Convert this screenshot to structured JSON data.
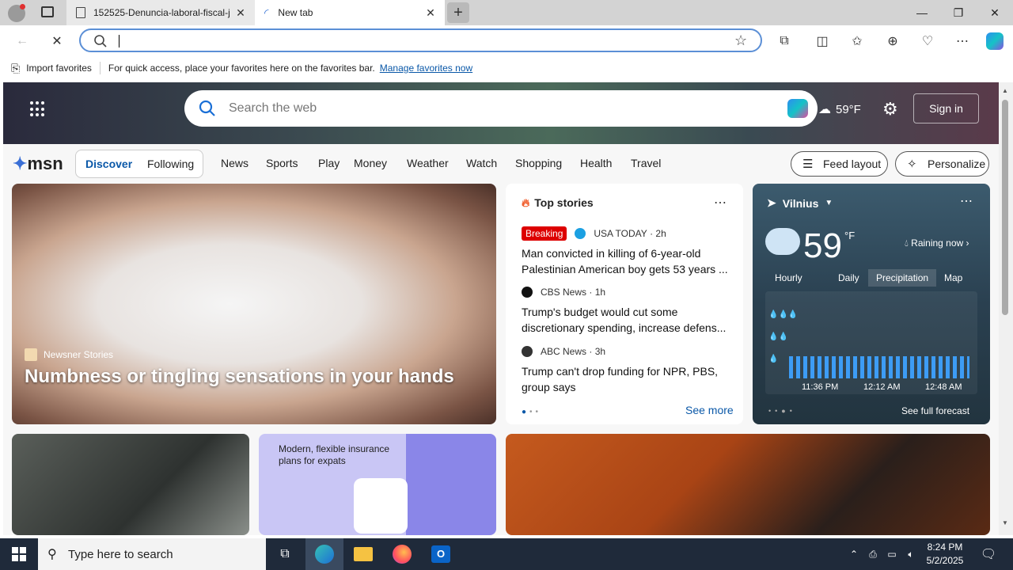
{
  "browser": {
    "tabs": [
      {
        "label": "152525-Denuncia-laboral-fiscal-j"
      },
      {
        "label": "New tab"
      }
    ],
    "address_value": "",
    "favorites_bar": {
      "import_label": "Import favorites",
      "message": "For quick access, place your favorites here on the favorites bar.",
      "manage_link": "Manage favorites now"
    }
  },
  "msn": {
    "search_placeholder": "Search the web",
    "weather_temp": "59°F",
    "sign_in": "Sign in",
    "logo": "msn",
    "segments": [
      "Discover",
      "Following"
    ],
    "nav": [
      "News",
      "Sports",
      "Play",
      "Money",
      "Weather",
      "Watch",
      "Shopping",
      "Health",
      "Travel"
    ],
    "feed_layout": "Feed layout",
    "personalize": "Personalize",
    "hero": {
      "source": "Newsner Stories",
      "title": "Numbness or tingling sensations in your hands"
    },
    "top_stories": {
      "heading": "Top stories",
      "items": [
        {
          "badge": "Breaking",
          "source": "USA TODAY",
          "age": "2h",
          "title": "Man convicted in killing of 6-year-old Palestinian American boy gets 53 years ..."
        },
        {
          "source": "CBS News",
          "age": "1h",
          "title": "Trump's budget would cut some discretionary spending, increase defens..."
        },
        {
          "source": "ABC News",
          "age": "3h",
          "title": "Trump can't drop funding for NPR, PBS, group says"
        }
      ],
      "see_more": "See more"
    },
    "weather": {
      "city": "Vilnius",
      "temp": "59",
      "unit": "°F",
      "condition": "Raining now",
      "tabs": [
        "Hourly",
        "Daily",
        "Precipitation",
        "Map"
      ],
      "times": [
        "11:36 PM",
        "12:12 AM",
        "12:48 AM"
      ],
      "see_full": "See full forecast"
    },
    "insurance_card": {
      "text": "Modern, flexible insurance plans for expats"
    }
  },
  "taskbar": {
    "search_placeholder": "Type here to search",
    "time": "8:24 PM",
    "date": "5/2/2025"
  },
  "colors": {
    "accent": "#0a58a8",
    "breaking": "#dd0000",
    "taskbar": "#1f2a3a"
  }
}
